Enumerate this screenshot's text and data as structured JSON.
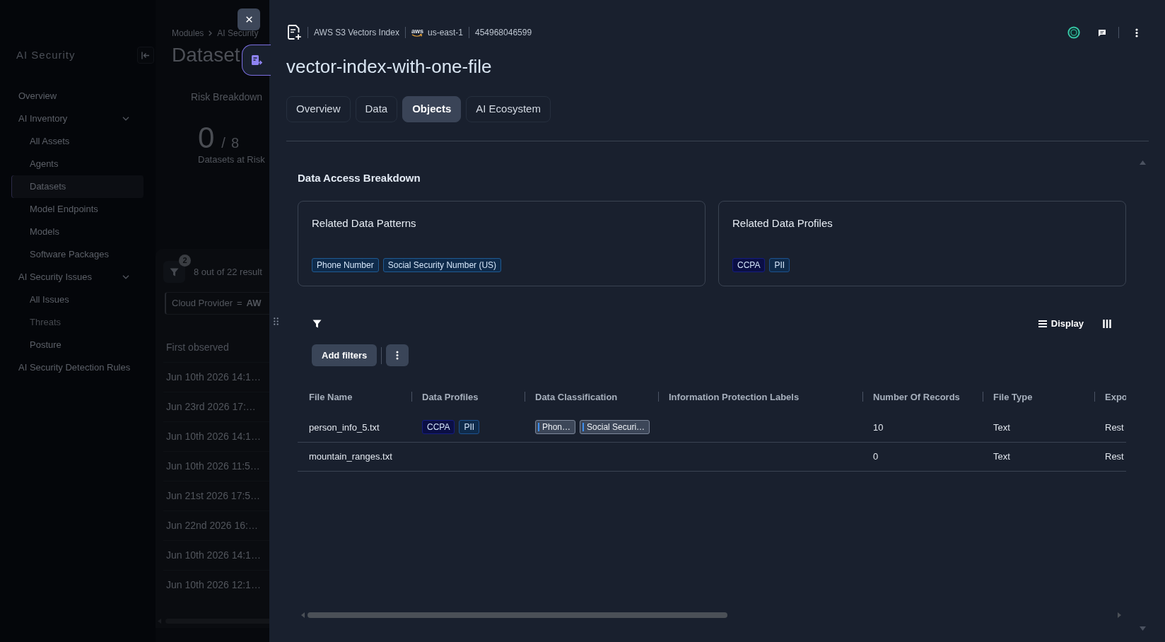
{
  "background_page": {
    "sidebar": {
      "title": "AI Security",
      "items": [
        {
          "label": "Overview",
          "selected": false,
          "disabled": false
        },
        {
          "label": "AI Inventory",
          "selected": false,
          "disabled": false,
          "expanded": true,
          "children": [
            {
              "label": "All Assets",
              "selected": false,
              "disabled": false
            },
            {
              "label": "Agents",
              "selected": false,
              "disabled": false
            },
            {
              "label": "Datasets",
              "selected": true,
              "disabled": false
            },
            {
              "label": "Model Endpoints",
              "selected": false,
              "disabled": false
            },
            {
              "label": "Models",
              "selected": false,
              "disabled": false
            },
            {
              "label": "Software Packages",
              "selected": false,
              "disabled": false
            }
          ]
        },
        {
          "label": "AI Security Issues",
          "selected": false,
          "disabled": false,
          "expanded": true,
          "children": [
            {
              "label": "All Issues",
              "selected": false,
              "disabled": false
            },
            {
              "label": "Threats",
              "selected": false,
              "disabled": true
            },
            {
              "label": "Posture",
              "selected": false,
              "disabled": false
            }
          ]
        },
        {
          "label": "AI Security Detection Rules",
          "selected": false,
          "disabled": false
        }
      ]
    },
    "breadcrumb": [
      "Modules",
      "AI Security"
    ],
    "title": "Dataset",
    "risk_breakdown": {
      "label": "Risk Breakdown",
      "count": "0",
      "separator": "/",
      "total": "8",
      "caption": "Datasets at Risk"
    },
    "results": {
      "filter_count": "2",
      "summary": "8 out of 22 result",
      "filter_chip": {
        "field": "Cloud Provider",
        "operator": "=",
        "value": "AW"
      },
      "column": "First observed",
      "rows": [
        "Jun 10th 2026 14:1…",
        "Jun 23rd 2026 17:…",
        "Jun 10th 2026 14:1…",
        "Jun 10th 2026 11:5…",
        "Jun 21st 2026 17:5…",
        "Jun 22nd 2026 16:…",
        "Jun 10th 2026 14:1…",
        "Jun 10th 2026 12:1…"
      ]
    }
  },
  "panel": {
    "header": {
      "resource_type": "AWS S3 Vectors Index",
      "provider_logo": "aws",
      "region": "us-east-1",
      "account_id": "454968046599"
    },
    "title": "vector-index-with-one-file",
    "tabs": [
      {
        "label": "Overview",
        "selected": false
      },
      {
        "label": "Data",
        "selected": false
      },
      {
        "label": "Objects",
        "selected": true
      },
      {
        "label": "AI Ecosystem",
        "selected": false
      }
    ],
    "section_title": "Data Access Breakdown",
    "cards": [
      {
        "title": "Related Data Patterns",
        "tags": [
          {
            "label": "Phone Number"
          },
          {
            "label": "Social Security Number (US)"
          }
        ]
      },
      {
        "title": "Related Data Profiles",
        "tags": [
          {
            "label": "CCPA",
            "color": "#0b0f44"
          },
          {
            "label": "PII",
            "color": "#0f2b4b"
          }
        ]
      }
    ],
    "toolbar": {
      "display_label": "Display",
      "add_filters_label": "Add filters"
    },
    "table": {
      "columns": [
        "File Name",
        "Data Profiles",
        "Data Classification",
        "Information Protection Labels",
        "Number Of Records",
        "File Type",
        "Expo"
      ],
      "rows": [
        {
          "file_name": "person_info_5.txt",
          "data_profiles": [
            {
              "label": "CCPA",
              "color": "#0b0f44"
            },
            {
              "label": "PII",
              "color": "#0f2b4b"
            }
          ],
          "data_classification": [
            "Phon…",
            "Social Securi…"
          ],
          "number_of_records": "10",
          "file_type": "Text",
          "column_7": "Rest"
        },
        {
          "file_name": "mountain_ranges.txt",
          "number_of_records": "0",
          "file_type": "Text",
          "column_7": "Rest"
        }
      ]
    }
  }
}
